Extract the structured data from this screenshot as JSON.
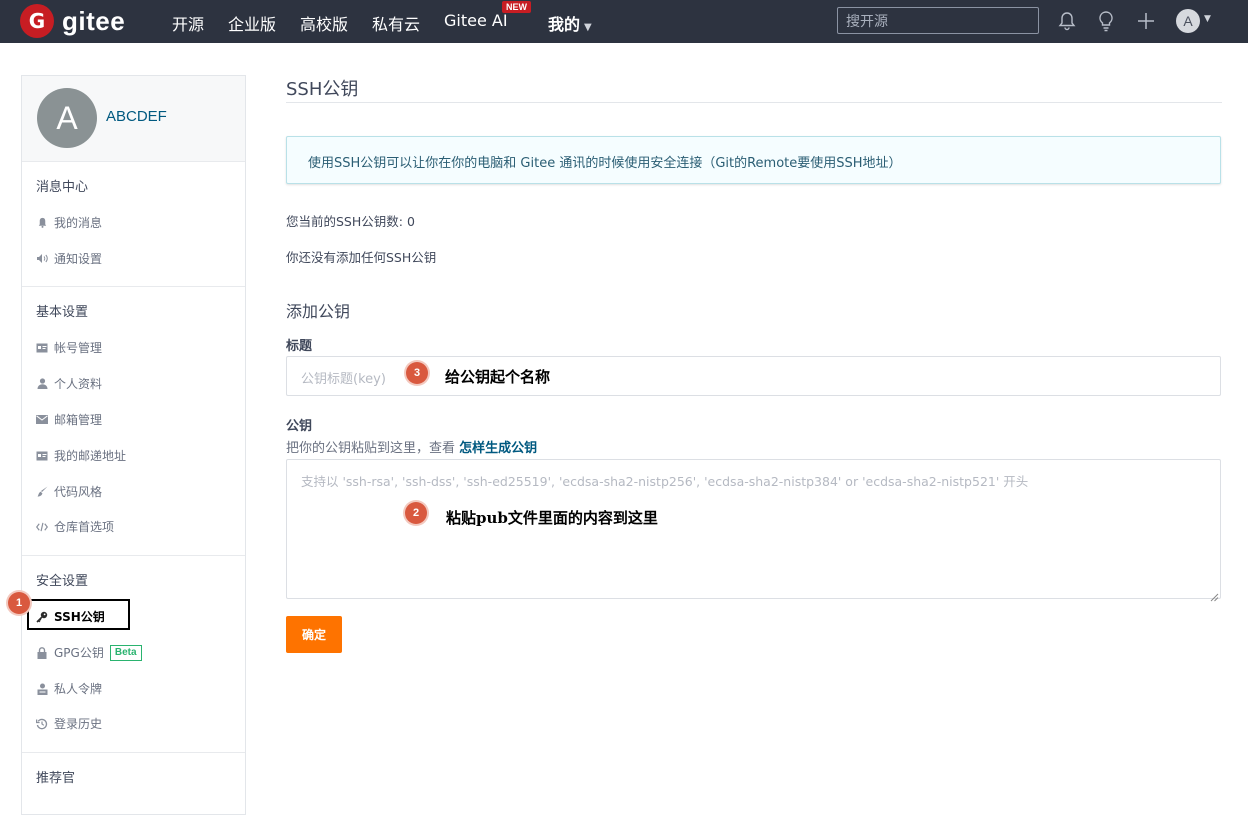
{
  "brand": {
    "logo_letter": "G",
    "name": "gitee"
  },
  "topnav": {
    "items": [
      "开源",
      "企业版",
      "高校版",
      "私有云",
      "Gitee AI",
      "我的"
    ],
    "new_badge": "NEW",
    "search_placeholder": "搜开源",
    "avatar_letter": "A"
  },
  "sidebar": {
    "avatar_letter": "A",
    "username": "ABCDEF",
    "sections": [
      {
        "title": "消息中心",
        "items": [
          {
            "label": "我的消息",
            "icon": "bell-icon"
          },
          {
            "label": "通知设置",
            "icon": "speaker-icon"
          }
        ]
      },
      {
        "title": "基本设置",
        "items": [
          {
            "label": "帐号管理",
            "icon": "id-card-icon"
          },
          {
            "label": "个人资料",
            "icon": "user-icon"
          },
          {
            "label": "邮箱管理",
            "icon": "envelope-icon"
          },
          {
            "label": "我的邮递地址",
            "icon": "address-card-icon"
          },
          {
            "label": "代码风格",
            "icon": "brush-icon"
          },
          {
            "label": "仓库首选项",
            "icon": "code-icon"
          }
        ]
      },
      {
        "title": "安全设置",
        "items": [
          {
            "label": "SSH公钥",
            "icon": "key-icon",
            "active": true
          },
          {
            "label": "GPG公钥",
            "icon": "lock-icon",
            "badge": "Beta"
          },
          {
            "label": "私人令牌",
            "icon": "token-icon"
          },
          {
            "label": "登录历史",
            "icon": "history-icon"
          }
        ]
      },
      {
        "title": "推荐官",
        "items": []
      }
    ]
  },
  "main": {
    "title": "SSH公钥",
    "info": "使用SSH公钥可以让你在你的电脑和 Gitee 通讯的时候使用安全连接（Git的Remote要使用SSH地址）",
    "count_text": "您当前的SSH公钥数: 0",
    "empty_text": "你还没有添加任何SSH公钥",
    "add_heading": "添加公钥",
    "title_label": "标题",
    "title_placeholder": "公钥标题(key)",
    "key_label": "公钥",
    "key_hint": "把你的公钥粘贴到这里，查看 ",
    "key_hint_link": "怎样生成公钥",
    "key_placeholder": "支持以 'ssh-rsa', 'ssh-dss', 'ssh-ed25519', 'ecdsa-sha2-nistp256', 'ecdsa-sha2-nistp384' or 'ecdsa-sha2-nistp521' 开头",
    "submit_label": "确定"
  },
  "annotations": {
    "step1": "1",
    "step2": "2",
    "step2_text": "粘贴pub文件里面的内容到这里",
    "step3": "3",
    "step3_text": "给公钥起个名称"
  },
  "colors": {
    "topbar": "#2d3340",
    "brand_red": "#c71d23",
    "button_orange": "#fe7300",
    "link_blue": "#005980",
    "beta_green": "#2ab36f",
    "annotation_badge": "#d9593f"
  }
}
